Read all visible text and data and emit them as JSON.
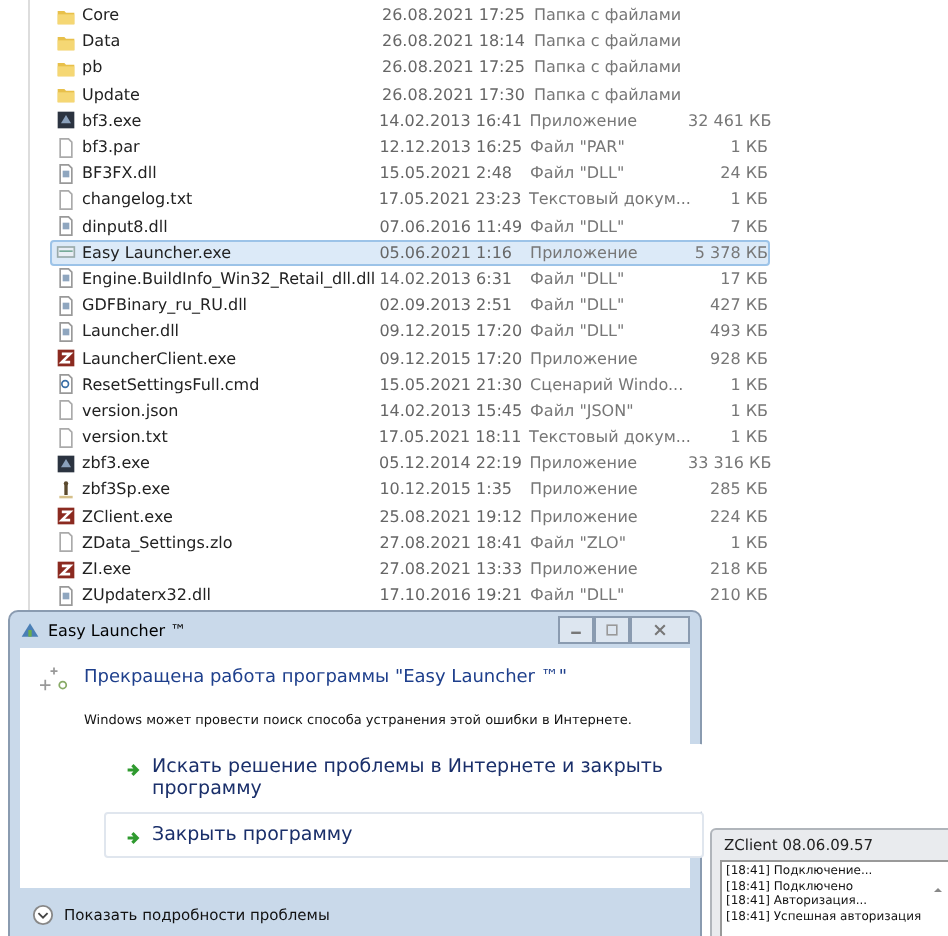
{
  "files": [
    {
      "name": "Core",
      "date": "26.08.2021 17:25",
      "type": "Папка с файлами",
      "kind": "folder",
      "selected": false
    },
    {
      "name": "Data",
      "date": "26.08.2021 18:14",
      "type": "Папка с файлами",
      "kind": "folder",
      "selected": false
    },
    {
      "name": "pb",
      "date": "26.08.2021 17:25",
      "type": "Папка с файлами",
      "kind": "folder",
      "selected": false
    },
    {
      "name": "Update",
      "date": "26.08.2021 17:30",
      "type": "Папка с файлами",
      "kind": "folder",
      "selected": false
    },
    {
      "name": "bf3.exe",
      "date": "14.02.2013 16:41",
      "type": "Приложение",
      "size": "32 461 КБ",
      "kind": "game",
      "selected": false
    },
    {
      "name": "bf3.par",
      "date": "12.12.2013 16:25",
      "type": "Файл \"PAR\"",
      "size": "1 КБ",
      "kind": "file",
      "selected": false
    },
    {
      "name": "BF3FX.dll",
      "date": "15.05.2021 2:48",
      "type": "Файл \"DLL\"",
      "size": "24 КБ",
      "kind": "dll",
      "selected": false
    },
    {
      "name": "changelog.txt",
      "date": "17.05.2021 23:23",
      "type": "Текстовый докум...",
      "size": "1 КБ",
      "kind": "file",
      "selected": false
    },
    {
      "name": "dinput8.dll",
      "date": "07.06.2016 11:49",
      "type": "Файл \"DLL\"",
      "size": "7 КБ",
      "kind": "dll",
      "selected": false
    },
    {
      "name": "Easy Launcher.exe",
      "date": "05.06.2021 1:16",
      "type": "Приложение",
      "size": "5 378 КБ",
      "kind": "exe",
      "selected": true
    },
    {
      "name": "Engine.BuildInfo_Win32_Retail_dll.dll",
      "date": "14.02.2013 6:31",
      "type": "Файл \"DLL\"",
      "size": "17 КБ",
      "kind": "dll",
      "selected": false
    },
    {
      "name": "GDFBinary_ru_RU.dll",
      "date": "02.09.2013 2:51",
      "type": "Файл \"DLL\"",
      "size": "427 КБ",
      "kind": "dll",
      "selected": false
    },
    {
      "name": "Launcher.dll",
      "date": "09.12.2015 17:20",
      "type": "Файл \"DLL\"",
      "size": "493 КБ",
      "kind": "dll",
      "selected": false
    },
    {
      "name": "LauncherClient.exe",
      "date": "09.12.2015 17:20",
      "type": "Приложение",
      "size": "928 КБ",
      "kind": "z",
      "selected": false
    },
    {
      "name": "ResetSettingsFull.cmd",
      "date": "15.05.2021 21:30",
      "type": "Сценарий Windo...",
      "size": "1 КБ",
      "kind": "cmd",
      "selected": false
    },
    {
      "name": "version.json",
      "date": "14.02.2013 15:45",
      "type": "Файл \"JSON\"",
      "size": "1 КБ",
      "kind": "file",
      "selected": false
    },
    {
      "name": "version.txt",
      "date": "17.05.2021 18:11",
      "type": "Текстовый докум...",
      "size": "1 КБ",
      "kind": "file",
      "selected": false
    },
    {
      "name": "zbf3.exe",
      "date": "05.12.2014 22:19",
      "type": "Приложение",
      "size": "33 316 КБ",
      "kind": "game",
      "selected": false
    },
    {
      "name": "zbf3Sp.exe",
      "date": "10.12.2015 1:35",
      "type": "Приложение",
      "size": "285 КБ",
      "kind": "figure",
      "selected": false
    },
    {
      "name": "ZClient.exe",
      "date": "25.08.2021 19:12",
      "type": "Приложение",
      "size": "224 КБ",
      "kind": "z",
      "selected": false
    },
    {
      "name": "ZData_Settings.zlo",
      "date": "27.08.2021 18:41",
      "type": "Файл \"ZLO\"",
      "size": "1 КБ",
      "kind": "file",
      "selected": false
    },
    {
      "name": "ZI.exe",
      "date": "27.08.2021 13:33",
      "type": "Приложение",
      "size": "218 КБ",
      "kind": "z",
      "selected": false
    },
    {
      "name": "ZUpdaterx32.dll",
      "date": "17.10.2016 19:21",
      "type": "Файл \"DLL\"",
      "size": "210 КБ",
      "kind": "dll",
      "selected": false
    }
  ],
  "dialog": {
    "title": "Easy Launcher ™",
    "heading": "Прекращена работа программы \"Easy Launcher ™\"",
    "message": "Windows может провести поиск способа устранения этой ошибки в Интернете.",
    "options": [
      {
        "label": "Искать решение проблемы в Интернете и закрыть программу",
        "selected": false
      },
      {
        "label": "Закрыть программу",
        "selected": true
      }
    ],
    "details": "Показать подробности проблемы"
  },
  "zclient": {
    "title": "ZClient 08.06.09.57",
    "log": [
      "[18:41] Подключение...",
      "[18:41] Подключено",
      "[18:41] Авторизация...",
      "[18:41] Успешная авторизация"
    ]
  }
}
